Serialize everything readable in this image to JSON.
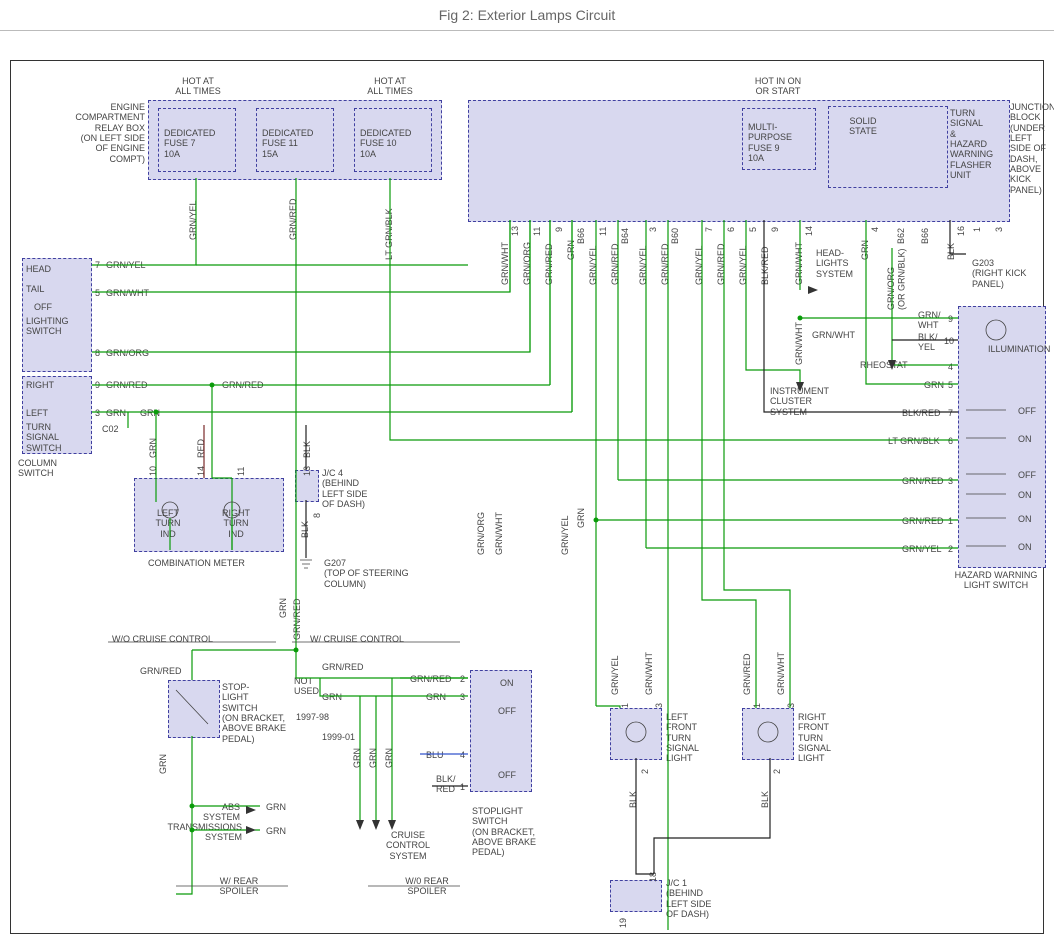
{
  "title": "Fig 2: Exterior Lamps Circuit",
  "header": {
    "hot_all_times_1": "HOT AT\nALL TIMES",
    "hot_all_times_2": "HOT AT\nALL TIMES",
    "hot_in_on": "HOT IN ON\nOR START"
  },
  "relay_box": {
    "label": "ENGINE\nCOMPARTMENT\nRELAY BOX\n(ON LEFT SIDE\nOF ENGINE\nCOMPT)",
    "fuse7": "DEDICATED\nFUSE 7\n10A",
    "fuse11": "DEDICATED\nFUSE 11\n15A",
    "fuse10": "DEDICATED\nFUSE 10\n10A"
  },
  "junction_block": {
    "label": "JUNCTION\nBLOCK\n(UNDER\nLEFT\nSIDE OF\nDASH,\nABOVE\nKICK\nPANEL)",
    "fuse9": "MULTI-\nPURPOSE\nFUSE 9\n10A",
    "solid_state": "SOLID\nSTATE",
    "flasher": "TURN\nSIGNAL\n&\nHAZARD\nWARNING\nFLASHER\nUNIT"
  },
  "column_switch": {
    "lighting_switch": "LIGHTING\nSWITCH",
    "head": "HEAD",
    "tail": "TAIL",
    "off": "OFF",
    "right": "RIGHT",
    "left": "LEFT",
    "turn_signal_switch": "TURN\nSIGNAL\nSWITCH",
    "column_switch": "COLUMN\nSWITCH"
  },
  "pin_labels": {
    "p7": "7",
    "p5": "5",
    "p8": "8",
    "p9": "9",
    "p3": "3",
    "c02": "C02"
  },
  "wires": {
    "grn_yel": "GRN/YEL",
    "grn_wht": "GRN/WHT",
    "grn_org": "GRN/ORG",
    "grn_red": "GRN/RED",
    "grn": "GRN",
    "lt_grn_blk": "LT GRN/BLK",
    "blk": "BLK",
    "blk_red": "BLK/RED",
    "red": "RED",
    "blu": "BLU",
    "blk_yel": "BLK/\nYEL",
    "grn_wht_or_blk": "GRN/ORG\n(OR GRN/BLK)"
  },
  "combination_meter": {
    "left_turn_ind": "LEFT\nTURN\nIND",
    "right_turn_ind": "RIGHT\nTURN\nIND",
    "label": "COMBINATION METER",
    "p10": "10",
    "p14": "14",
    "p11": "11",
    "p13": "13"
  },
  "jc4": {
    "label": "J/C 4\n(BEHIND\nLEFT SIDE\nOF DASH)",
    "blk8": "8"
  },
  "g207": "G207\n(TOP OF STEERING\nCOLUMN)",
  "g203": "G203\n(RIGHT KICK\nPANEL)",
  "headlights_system": "HEAD-\nLIGHTS\nSYSTEM",
  "rheostat": "RHEOSTAT",
  "instrument_cluster": "INSTRUMENT\nCLUSTER\nSYSTEM",
  "illumination": "ILLUMINATION",
  "hazard_switch": {
    "label": "HAZARD WARNING\nLIGHT SWITCH",
    "off": "OFF",
    "on": "ON",
    "p9": "9",
    "p10": "10",
    "p4": "4",
    "p5": "5",
    "p7": "7",
    "p6": "6",
    "p3": "3",
    "p1": "1",
    "p2": "2",
    "grn_wht9": "GRN/\nWHT",
    "blk_yel10": "BLK/\nYEL",
    "grn5": "GRN",
    "blk_red7": "BLK/RED",
    "lt_grn_blk6": "LT GRN/BLK",
    "grn_red3": "GRN/RED",
    "grn_red1": "GRN/RED",
    "grn_yel2": "GRN/YEL"
  },
  "stoplight_switch_wo": {
    "label": "STOP-\nLIGHT\nSWITCH\n(ON BRACKET,\nABOVE BRAKE\nPEDAL)"
  },
  "stoplight_switch_w": {
    "label": "STOPLIGHT\nSWITCH\n(ON BRACKET,\nABOVE BRAKE\nPEDAL)",
    "on": "ON",
    "off": "OFF",
    "p1": "1",
    "p2": "2",
    "p3": "3",
    "p4": "4",
    "grn_red2": "GRN/RED",
    "grn3": "GRN",
    "blu4": "BLU",
    "blk_red1": "BLK/\nRED"
  },
  "cruise": {
    "wo": "W/O CRUISE CONTROL",
    "w": "W/ CRUISE CONTROL",
    "grn_red": "GRN/RED",
    "not_used": "NOT\nUSED",
    "y97_98": "1997-98",
    "y99_01": "1999-01"
  },
  "abs": "ABS\nSYSTEM",
  "trans": "TRANSMISSIONS\nSYSTEM",
  "cruise_control_system": "CRUISE\nCONTROL\nSYSTEM",
  "rear_spoiler": {
    "w": "W/ REAR\nSPOILER",
    "wo": "W/0 REAR\nSPOILER"
  },
  "left_front_ts": "LEFT\nFRONT\nTURN\nSIGNAL\nLIGHT",
  "right_front_ts": "RIGHT\nFRONT\nTURN\nSIGNAL\nLIGHT",
  "jc1": "J/C 1\n(BEHIND\nLEFT SIDE\nOF DASH)",
  "blk2": "BLK",
  "p_nums": {
    "p1": "1",
    "p2": "2",
    "p3": "3",
    "p18": "18",
    "p19": "19",
    "p13": "13",
    "p11": "11",
    "p14": "14",
    "p16": "16"
  },
  "junction_pins": {
    "p13": "13",
    "p11": "11",
    "p9b": "9",
    "pB66": "B66",
    "p11b": "11",
    "pB64": "B64",
    "p3b": "3",
    "pB60": "B60",
    "p7b": "7",
    "p6b": "6",
    "p5b": "5",
    "p9c": "9",
    "p14b": "14",
    "p4b": "4",
    "pB62": "B62",
    "pB66b": "B66",
    "p16b": "16",
    "p1b": "1",
    "p3c": "3"
  }
}
